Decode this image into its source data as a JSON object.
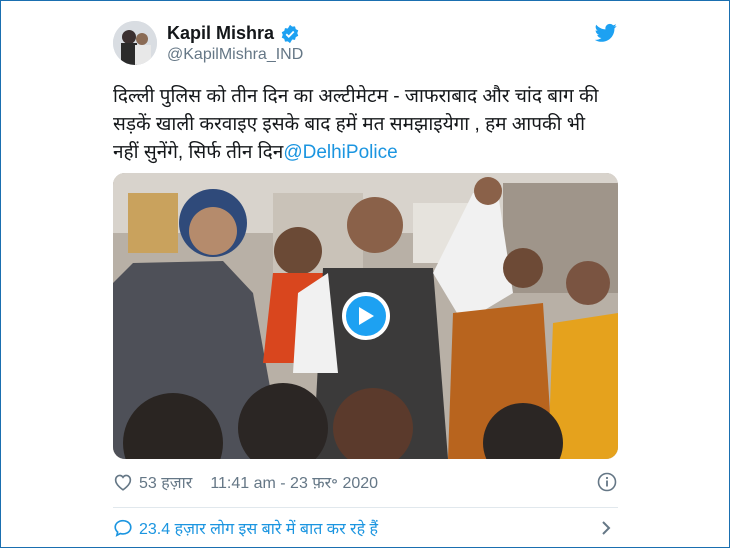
{
  "tweet": {
    "author_name": "Kapil Mishra",
    "handle": "@KapilMishra_IND",
    "text_line1": "दिल्ली पुलिस को तीन दिन का अल्टीमेटम - जाफराबाद और चांद बाग की",
    "text_line2": "सड़कें खाली करवाइए इसके बाद हमें मत समझाइयेगा , हम आपकी भी",
    "text_line3": "नहीं सुनेंगे, सिर्फ तीन दिन",
    "mention": "@DelhiPolice"
  },
  "footer": {
    "likes": "53 हज़ार",
    "timestamp": "11:41 am - 23 फ़र॰ 2020"
  },
  "conversation": {
    "label": "23.4 हज़ार लोग इस बारे में बात कर रहे हैं"
  },
  "colors": {
    "brand_blue": "#1da1f2",
    "link_blue": "#1b95e0",
    "frame_border": "#1a6fb0"
  },
  "icons": [
    "verified-badge-icon",
    "twitter-bird-icon",
    "play-icon",
    "heart-icon",
    "info-icon",
    "speech-bubble-icon",
    "chevron-right-icon"
  ]
}
